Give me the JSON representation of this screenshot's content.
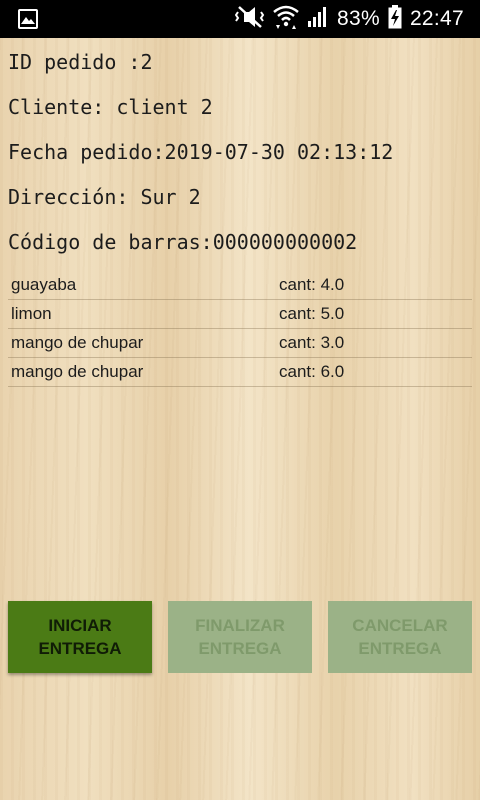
{
  "status_bar": {
    "battery_percent": "83%",
    "time": "22:47",
    "icons": [
      "gallery-icon",
      "mute-vibrate-icon",
      "wifi-icon",
      "signal-icon",
      "battery-charging-icon"
    ]
  },
  "order": {
    "id_line": "ID pedido :2",
    "client_line": "Cliente: client 2",
    "date_line": "Fecha pedido:2019-07-30 02:13:12",
    "address_line": "Dirección: Sur 2",
    "barcode_line": "Código de barras:000000000002"
  },
  "items": [
    {
      "name": "guayaba",
      "qty": "cant: 4.0"
    },
    {
      "name": "limon",
      "qty": "cant: 5.0"
    },
    {
      "name": "mango de chupar",
      "qty": "cant: 3.0"
    },
    {
      "name": "mango de chupar",
      "qty": "cant: 6.0"
    }
  ],
  "actions": {
    "start": {
      "line1": "INICIAR",
      "line2": "ENTREGA",
      "enabled": true
    },
    "finish": {
      "line1": "FINALIZAR",
      "line2": "ENTREGA",
      "enabled": false
    },
    "cancel": {
      "line1": "CANCELAR",
      "line2": "ENTREGA",
      "enabled": false
    }
  },
  "colors": {
    "primary_button": "#4b7b15",
    "disabled_button": "#9bb287",
    "status_bar": "#000000"
  }
}
